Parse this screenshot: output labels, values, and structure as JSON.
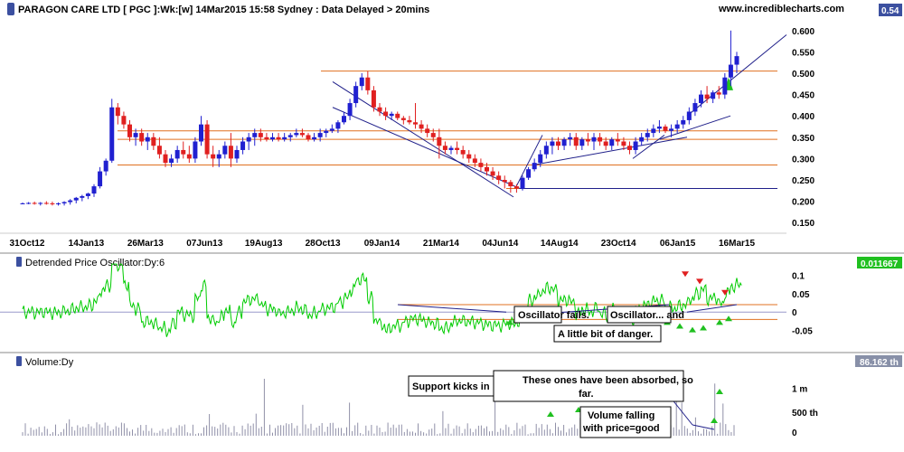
{
  "header": {
    "title": "PARAGON CARE LTD [ PGC ]:Wk:[w]  14Mar2015 15:58 Sydney : Data Delayed > 20mins",
    "brand": "www.incrediblecharts.com",
    "last_value": "0.54"
  },
  "colors": {
    "up": "#2020d0",
    "down": "#e02020",
    "support": "#e07020",
    "trend": "#20208a",
    "oscillator": "#00cc00",
    "volume": "#9090a8",
    "badge_blue": "#3c50a0",
    "badge_green": "#20c020"
  },
  "chart_data": [
    {
      "type": "candlestick",
      "panel": "price",
      "y_ticks": [
        "0.600",
        "0.550",
        "0.500",
        "0.450",
        "0.400",
        "0.350",
        "0.300",
        "0.250",
        "0.200",
        "0.150"
      ],
      "ylim": [
        0.125,
        0.625
      ],
      "x_ticks": [
        "31Oct12",
        "14Jan13",
        "26Mar13",
        "07Jun13",
        "19Aug13",
        "28Oct13",
        "09Jan14",
        "21Mar14",
        "04Jun14",
        "14Aug14",
        "23Oct14",
        "06Jan15",
        "16Mar15"
      ],
      "support_levels": [
        0.505,
        0.365,
        0.345,
        0.285,
        0.23
      ],
      "candles": [
        [
          0.195,
          0.197,
          0.193,
          0.195
        ],
        [
          0.195,
          0.198,
          0.193,
          0.196
        ],
        [
          0.196,
          0.199,
          0.192,
          0.194
        ],
        [
          0.194,
          0.198,
          0.19,
          0.196
        ],
        [
          0.196,
          0.2,
          0.192,
          0.195
        ],
        [
          0.195,
          0.199,
          0.19,
          0.193
        ],
        [
          0.193,
          0.197,
          0.19,
          0.195
        ],
        [
          0.195,
          0.2,
          0.19,
          0.198
        ],
        [
          0.198,
          0.205,
          0.192,
          0.202
        ],
        [
          0.202,
          0.21,
          0.195,
          0.208
        ],
        [
          0.208,
          0.215,
          0.2,
          0.212
        ],
        [
          0.212,
          0.22,
          0.205,
          0.218
        ],
        [
          0.218,
          0.24,
          0.21,
          0.235
        ],
        [
          0.235,
          0.28,
          0.23,
          0.27
        ],
        [
          0.27,
          0.3,
          0.26,
          0.295
        ],
        [
          0.295,
          0.44,
          0.29,
          0.42
        ],
        [
          0.42,
          0.43,
          0.38,
          0.4
        ],
        [
          0.4,
          0.41,
          0.37,
          0.38
        ],
        [
          0.38,
          0.39,
          0.34,
          0.35
        ],
        [
          0.35,
          0.37,
          0.33,
          0.36
        ],
        [
          0.36,
          0.37,
          0.33,
          0.34
        ],
        [
          0.34,
          0.36,
          0.32,
          0.35
        ],
        [
          0.35,
          0.36,
          0.32,
          0.33
        ],
        [
          0.33,
          0.35,
          0.3,
          0.31
        ],
        [
          0.31,
          0.32,
          0.28,
          0.29
        ],
        [
          0.29,
          0.31,
          0.28,
          0.3
        ],
        [
          0.3,
          0.33,
          0.29,
          0.32
        ],
        [
          0.32,
          0.34,
          0.3,
          0.31
        ],
        [
          0.31,
          0.33,
          0.29,
          0.3
        ],
        [
          0.3,
          0.35,
          0.29,
          0.34
        ],
        [
          0.34,
          0.4,
          0.33,
          0.38
        ],
        [
          0.38,
          0.39,
          0.3,
          0.31
        ],
        [
          0.31,
          0.33,
          0.28,
          0.3
        ],
        [
          0.3,
          0.32,
          0.28,
          0.31
        ],
        [
          0.31,
          0.34,
          0.3,
          0.33
        ],
        [
          0.33,
          0.36,
          0.28,
          0.3
        ],
        [
          0.3,
          0.33,
          0.29,
          0.32
        ],
        [
          0.32,
          0.35,
          0.31,
          0.34
        ],
        [
          0.34,
          0.36,
          0.32,
          0.35
        ],
        [
          0.35,
          0.37,
          0.33,
          0.36
        ],
        [
          0.36,
          0.37,
          0.34,
          0.35
        ],
        [
          0.35,
          0.36,
          0.34,
          0.345
        ],
        [
          0.345,
          0.36,
          0.34,
          0.35
        ],
        [
          0.35,
          0.36,
          0.34,
          0.345
        ],
        [
          0.345,
          0.36,
          0.34,
          0.35
        ],
        [
          0.35,
          0.36,
          0.34,
          0.355
        ],
        [
          0.355,
          0.37,
          0.35,
          0.36
        ],
        [
          0.36,
          0.37,
          0.35,
          0.355
        ],
        [
          0.355,
          0.36,
          0.34,
          0.345
        ],
        [
          0.345,
          0.36,
          0.34,
          0.35
        ],
        [
          0.35,
          0.37,
          0.34,
          0.36
        ],
        [
          0.36,
          0.37,
          0.35,
          0.365
        ],
        [
          0.365,
          0.38,
          0.36,
          0.37
        ],
        [
          0.37,
          0.39,
          0.36,
          0.385
        ],
        [
          0.385,
          0.41,
          0.38,
          0.4
        ],
        [
          0.4,
          0.44,
          0.39,
          0.43
        ],
        [
          0.43,
          0.48,
          0.42,
          0.47
        ],
        [
          0.47,
          0.5,
          0.46,
          0.49
        ],
        [
          0.49,
          0.505,
          0.45,
          0.46
        ],
        [
          0.46,
          0.47,
          0.41,
          0.42
        ],
        [
          0.42,
          0.43,
          0.4,
          0.41
        ],
        [
          0.41,
          0.42,
          0.39,
          0.4
        ],
        [
          0.4,
          0.41,
          0.39,
          0.405
        ],
        [
          0.405,
          0.41,
          0.39,
          0.395
        ],
        [
          0.395,
          0.4,
          0.38,
          0.39
        ],
        [
          0.39,
          0.4,
          0.38,
          0.385
        ],
        [
          0.385,
          0.43,
          0.37,
          0.38
        ],
        [
          0.38,
          0.39,
          0.36,
          0.37
        ],
        [
          0.37,
          0.38,
          0.35,
          0.36
        ],
        [
          0.36,
          0.37,
          0.34,
          0.35
        ],
        [
          0.35,
          0.37,
          0.3,
          0.33
        ],
        [
          0.33,
          0.34,
          0.31,
          0.32
        ],
        [
          0.32,
          0.33,
          0.31,
          0.325
        ],
        [
          0.325,
          0.34,
          0.31,
          0.32
        ],
        [
          0.32,
          0.33,
          0.3,
          0.31
        ],
        [
          0.31,
          0.32,
          0.29,
          0.3
        ],
        [
          0.3,
          0.31,
          0.28,
          0.29
        ],
        [
          0.29,
          0.3,
          0.27,
          0.28
        ],
        [
          0.28,
          0.29,
          0.26,
          0.27
        ],
        [
          0.27,
          0.28,
          0.25,
          0.26
        ],
        [
          0.26,
          0.27,
          0.24,
          0.25
        ],
        [
          0.25,
          0.26,
          0.23,
          0.245
        ],
        [
          0.245,
          0.25,
          0.22,
          0.235
        ],
        [
          0.235,
          0.24,
          0.22,
          0.23
        ],
        [
          0.23,
          0.26,
          0.225,
          0.255
        ],
        [
          0.255,
          0.28,
          0.25,
          0.275
        ],
        [
          0.275,
          0.3,
          0.27,
          0.29
        ],
        [
          0.29,
          0.32,
          0.28,
          0.31
        ],
        [
          0.31,
          0.34,
          0.3,
          0.33
        ],
        [
          0.33,
          0.35,
          0.31,
          0.34
        ],
        [
          0.34,
          0.35,
          0.32,
          0.33
        ],
        [
          0.33,
          0.35,
          0.32,
          0.345
        ],
        [
          0.345,
          0.36,
          0.33,
          0.35
        ],
        [
          0.35,
          0.36,
          0.32,
          0.33
        ],
        [
          0.33,
          0.35,
          0.32,
          0.345
        ],
        [
          0.345,
          0.36,
          0.33,
          0.34
        ],
        [
          0.34,
          0.36,
          0.32,
          0.35
        ],
        [
          0.35,
          0.36,
          0.33,
          0.34
        ],
        [
          0.34,
          0.35,
          0.32,
          0.33
        ],
        [
          0.33,
          0.35,
          0.32,
          0.345
        ],
        [
          0.345,
          0.36,
          0.33,
          0.34
        ],
        [
          0.34,
          0.35,
          0.32,
          0.33
        ],
        [
          0.33,
          0.34,
          0.31,
          0.32
        ],
        [
          0.32,
          0.35,
          0.31,
          0.34
        ],
        [
          0.34,
          0.36,
          0.33,
          0.35
        ],
        [
          0.35,
          0.37,
          0.34,
          0.36
        ],
        [
          0.36,
          0.38,
          0.35,
          0.37
        ],
        [
          0.37,
          0.39,
          0.36,
          0.375
        ],
        [
          0.375,
          0.38,
          0.36,
          0.365
        ],
        [
          0.365,
          0.38,
          0.35,
          0.37
        ],
        [
          0.37,
          0.39,
          0.36,
          0.38
        ],
        [
          0.38,
          0.4,
          0.37,
          0.39
        ],
        [
          0.39,
          0.42,
          0.38,
          0.41
        ],
        [
          0.41,
          0.44,
          0.4,
          0.43
        ],
        [
          0.43,
          0.46,
          0.42,
          0.45
        ],
        [
          0.45,
          0.47,
          0.43,
          0.44
        ],
        [
          0.44,
          0.46,
          0.43,
          0.455
        ],
        [
          0.455,
          0.47,
          0.44,
          0.45
        ],
        [
          0.45,
          0.5,
          0.44,
          0.49
        ],
        [
          0.49,
          0.6,
          0.47,
          0.52
        ],
        [
          0.52,
          0.55,
          0.5,
          0.54
        ]
      ]
    },
    {
      "type": "line",
      "panel": "oscillator",
      "title": "Detrended Price Oscillator:Dy:6",
      "last_value": "0.011667",
      "y_ticks": [
        "0.1",
        "0.05",
        "0",
        "-0.05"
      ],
      "ylim": [
        -0.09,
        0.14
      ],
      "support_levels": [
        0.02,
        -0.02
      ]
    },
    {
      "type": "bar",
      "panel": "volume",
      "title": "Volume:Dy",
      "last_value": "86.162 th",
      "y_ticks": [
        "1 m",
        "500 th",
        "0"
      ],
      "ylim": [
        0,
        1600000
      ]
    }
  ],
  "annotations": {
    "osc_note_1": "Oscillator fails.",
    "osc_note_2": "Oscillator... and",
    "osc_note_3": "A little bit of danger.",
    "vol_note_1": "Support kicks in",
    "vol_note_2_line1": "These ones have been absorbed, so",
    "vol_note_2_line2": "far.",
    "vol_note_3_line1": "Volume falling",
    "vol_note_3_line2": "with price=good"
  }
}
